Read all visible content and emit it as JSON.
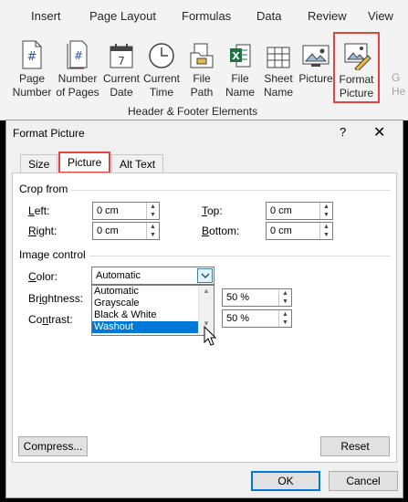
{
  "ribbon": {
    "tabs": [
      "Insert",
      "Page Layout",
      "Formulas",
      "Data",
      "Review",
      "View"
    ],
    "buttons": [
      {
        "label1": "Page",
        "label2": "Number",
        "icon": "page-number-icon"
      },
      {
        "label1": "Number",
        "label2": "of Pages",
        "icon": "number-of-pages-icon"
      },
      {
        "label1": "Current",
        "label2": "Date",
        "icon": "calendar-icon"
      },
      {
        "label1": "Current",
        "label2": "Time",
        "icon": "clock-icon"
      },
      {
        "label1": "File",
        "label2": "Path",
        "icon": "folder-icon"
      },
      {
        "label1": "File",
        "label2": "Name",
        "icon": "excel-file-icon"
      },
      {
        "label1": "Sheet",
        "label2": "Name",
        "icon": "sheet-grid-icon"
      },
      {
        "label1": "Picture",
        "label2": "",
        "icon": "picture-icon"
      },
      {
        "label1": "Format",
        "label2": "Picture",
        "icon": "format-picture-icon"
      }
    ],
    "cut_label_top": "G",
    "cut_label_bottom": "He",
    "group_label": "Header & Footer Elements"
  },
  "dialog": {
    "title": "Format Picture",
    "help": "?",
    "close": "✕",
    "tabs": [
      "Size",
      "Picture",
      "Alt Text"
    ],
    "active_tab": "Picture",
    "crop_from": {
      "heading": "Crop from",
      "left_label": "Left:",
      "right_label": "Right:",
      "top_label": "Top:",
      "bottom_label": "Bottom:",
      "left": "0 cm",
      "right": "0 cm",
      "top": "0 cm",
      "bottom": "0 cm"
    },
    "image_control": {
      "heading": "Image control",
      "color_label": "Color:",
      "color_value": "Automatic",
      "color_options": [
        "Automatic",
        "Grayscale",
        "Black & White",
        "Washout"
      ],
      "highlighted_option": "Washout",
      "brightness_label": "Brightness:",
      "brightness": "50 %",
      "contrast_label": "Contrast:",
      "contrast": "50 %"
    },
    "compress_label": "Compress...",
    "reset_label": "Reset",
    "ok_label": "OK",
    "cancel_label": "Cancel"
  },
  "colors": {
    "highlight_border": "#e0463f",
    "selection": "#0078d7",
    "excel_green": "#217346"
  }
}
